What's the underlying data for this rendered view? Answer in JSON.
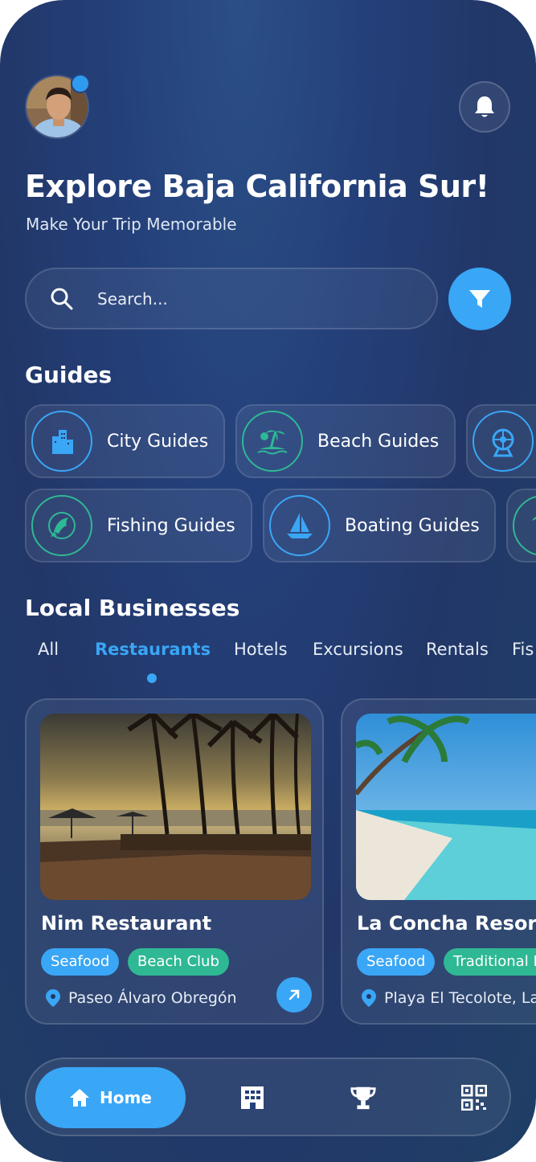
{
  "header": {
    "title": "Explore Baja California Sur!",
    "subtitle": "Make Your Trip Memorable"
  },
  "search": {
    "placeholder": "Search..."
  },
  "guides": {
    "title": "Guides",
    "row1": [
      {
        "label": "City Guides",
        "icon": "city-buildings-icon"
      },
      {
        "label": "Beach Guides",
        "icon": "beach-island-icon"
      },
      {
        "label": "",
        "icon": "ferris-wheel-icon"
      }
    ],
    "row2": [
      {
        "label": "Fishing Guides",
        "icon": "fish-icon"
      },
      {
        "label": "Boating Guides",
        "icon": "sailboat-icon"
      },
      {
        "label": "",
        "icon": "palm-icon"
      }
    ]
  },
  "local": {
    "title": "Local Businesses",
    "tabs": [
      "All",
      "Restaurants",
      "Hotels",
      "Excursions",
      "Rentals",
      "Fis"
    ],
    "active_tab": "Restaurants"
  },
  "cards": [
    {
      "name": "Nim Restaurant",
      "tags": [
        "Seafood",
        "Beach Club"
      ],
      "location": "Paseo Álvaro Obregón"
    },
    {
      "name": "La Concha Resort",
      "tags": [
        "Seafood",
        "Traditional M"
      ],
      "location": "Playa El Tecolote, La P"
    }
  ],
  "nav": {
    "home_label": "Home",
    "items": [
      "home-icon",
      "building-icon",
      "trophy-icon",
      "qr-code-icon"
    ]
  },
  "colors": {
    "accent": "#3aa6f6",
    "green": "#2fb894",
    "background": "#223768"
  }
}
